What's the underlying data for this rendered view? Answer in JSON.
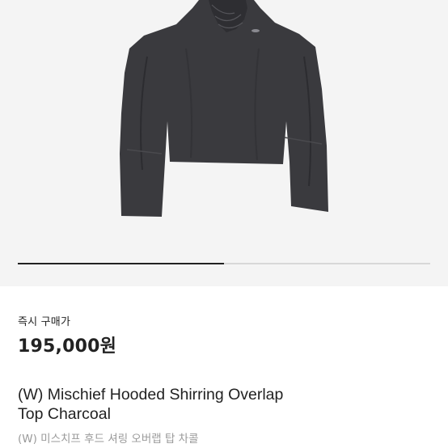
{
  "gallery": {
    "image_alt": "(W) Mischief Hooded Shirring Overlap Top Charcoal",
    "progress": 0.5
  },
  "product": {
    "badge": "즉시 구매가",
    "price": "195,000원",
    "title_line1": "(W) Mischief Hooded Shirring Overlap",
    "title_line2": "Top Charcoal",
    "subtitle": "(W) 미스치프 후드 셔링 오버랩 탑 차콜"
  },
  "colors": {
    "garment": "#3a3a3e",
    "background": "#f4f4f4",
    "text": "#222222",
    "muted": "#9a9a9a"
  }
}
